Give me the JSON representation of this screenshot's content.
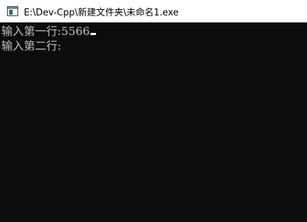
{
  "window": {
    "title": "E:\\Dev-Cpp\\新建文件夹\\未命名1.exe",
    "icon": "console-app-icon"
  },
  "console": {
    "lines": [
      {
        "text": "输入第一行:5566",
        "cursor": true
      },
      {
        "text": "输入第二行:"
      }
    ],
    "colors": {
      "background": "#0c0c0c",
      "text": "#c0c0c0",
      "cursor": "#ffffff"
    }
  }
}
